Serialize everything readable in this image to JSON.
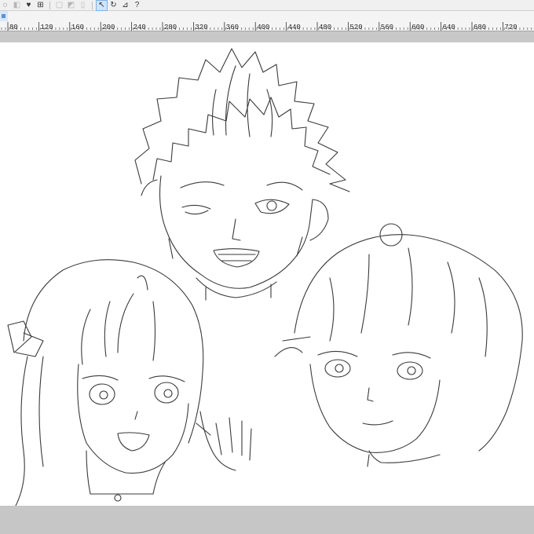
{
  "toolbar": {
    "tools": [
      {
        "name": "lasso-icon",
        "glyph": "◌",
        "state": "normal"
      },
      {
        "name": "shape-icon",
        "glyph": "◧",
        "state": "dim"
      },
      {
        "name": "fill-icon",
        "glyph": "♥",
        "state": "normal"
      },
      {
        "name": "grid-icon",
        "glyph": "⊞",
        "state": "normal"
      },
      {
        "name": "sep"
      },
      {
        "name": "blank-icon",
        "glyph": "▢",
        "state": "dim"
      },
      {
        "name": "ruler-tool-icon",
        "glyph": "◩",
        "state": "dim"
      },
      {
        "name": "page-icon",
        "glyph": "▯",
        "state": "dim"
      },
      {
        "name": "sep"
      },
      {
        "name": "select-icon",
        "glyph": "↖",
        "state": "on"
      },
      {
        "name": "rotate-icon",
        "glyph": "↻",
        "state": "normal"
      },
      {
        "name": "text-tool-icon",
        "glyph": "⊿",
        "state": "normal"
      },
      {
        "name": "help-icon",
        "glyph": "?",
        "state": "normal"
      }
    ]
  },
  "ruler": {
    "labels": [
      "80",
      "120",
      "160",
      "200",
      "240",
      "280",
      "320",
      "360",
      "400",
      "440",
      "480",
      "520",
      "560",
      "600",
      "640",
      "680",
      "720"
    ]
  }
}
